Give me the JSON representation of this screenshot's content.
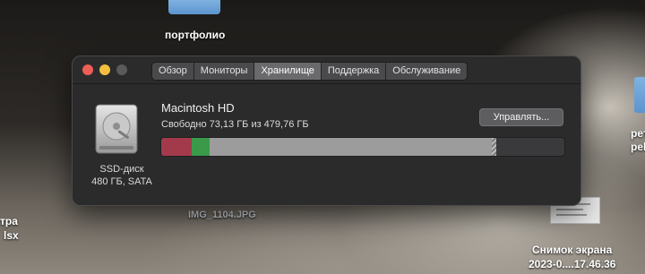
{
  "desktop": {
    "portfolio_label": "портфолио",
    "image_label": "IMG_1104.JPG",
    "left_label_1": "тра",
    "left_label_2": "lsx",
    "right_label": "рет",
    "right_label_2": "pels",
    "screenshot_label_1": "Снимок экрана",
    "screenshot_label_2": "2023-0....17.46.36"
  },
  "window": {
    "tabs": [
      "Обзор",
      "Мониторы",
      "Хранилище",
      "Поддержка",
      "Обслуживание"
    ],
    "active_tab_index": 2
  },
  "disk": {
    "type_label": "SSD-диск",
    "capacity_label": "480 ГБ, SATA",
    "volume_name": "Macintosh HD",
    "free_text": "Свободно 73,13 ГБ из 479,76 ГБ",
    "manage_button": "Управлять..."
  },
  "storage_bar": {
    "total_gb": 479.76,
    "free_gb": 73.13,
    "segments": [
      {
        "category": "apps",
        "fraction": 0.075,
        "color": "#a23a4c"
      },
      {
        "category": "docs",
        "fraction": 0.046,
        "color": "#3a9a4a"
      },
      {
        "category": "other",
        "fraction": 0.698,
        "color": "#9c9c9c"
      },
      {
        "category": "purgeable",
        "fraction": 0.012,
        "color": "hatched"
      }
    ]
  }
}
